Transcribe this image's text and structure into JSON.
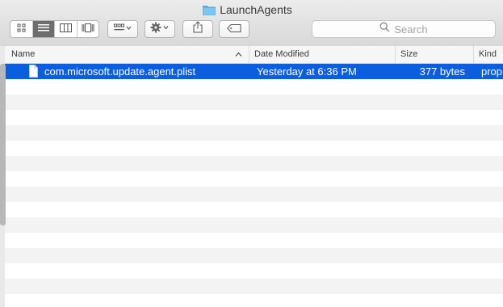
{
  "window": {
    "title": "LaunchAgents"
  },
  "toolbar": {
    "view_icons": "icon-view-icon",
    "view_list": "list-view-icon",
    "view_columns": "column-view-icon",
    "view_gallery": "coverflow-view-icon",
    "group_by": "arrange-icon",
    "action": "gear-icon",
    "share": "share-icon",
    "tags": "tag-icon"
  },
  "search": {
    "placeholder": "Search"
  },
  "columns": [
    {
      "label": "Name"
    },
    {
      "label": "Date Modified"
    },
    {
      "label": "Size"
    },
    {
      "label": "Kind"
    }
  ],
  "files": [
    {
      "name": "com.microsoft.update.agent.plist",
      "date": "Yesterday at 6:36 PM",
      "size": "377 bytes",
      "kind": "prop"
    }
  ],
  "colors": {
    "selection": "#0b5ee0",
    "folder": "#5fb5ec"
  }
}
